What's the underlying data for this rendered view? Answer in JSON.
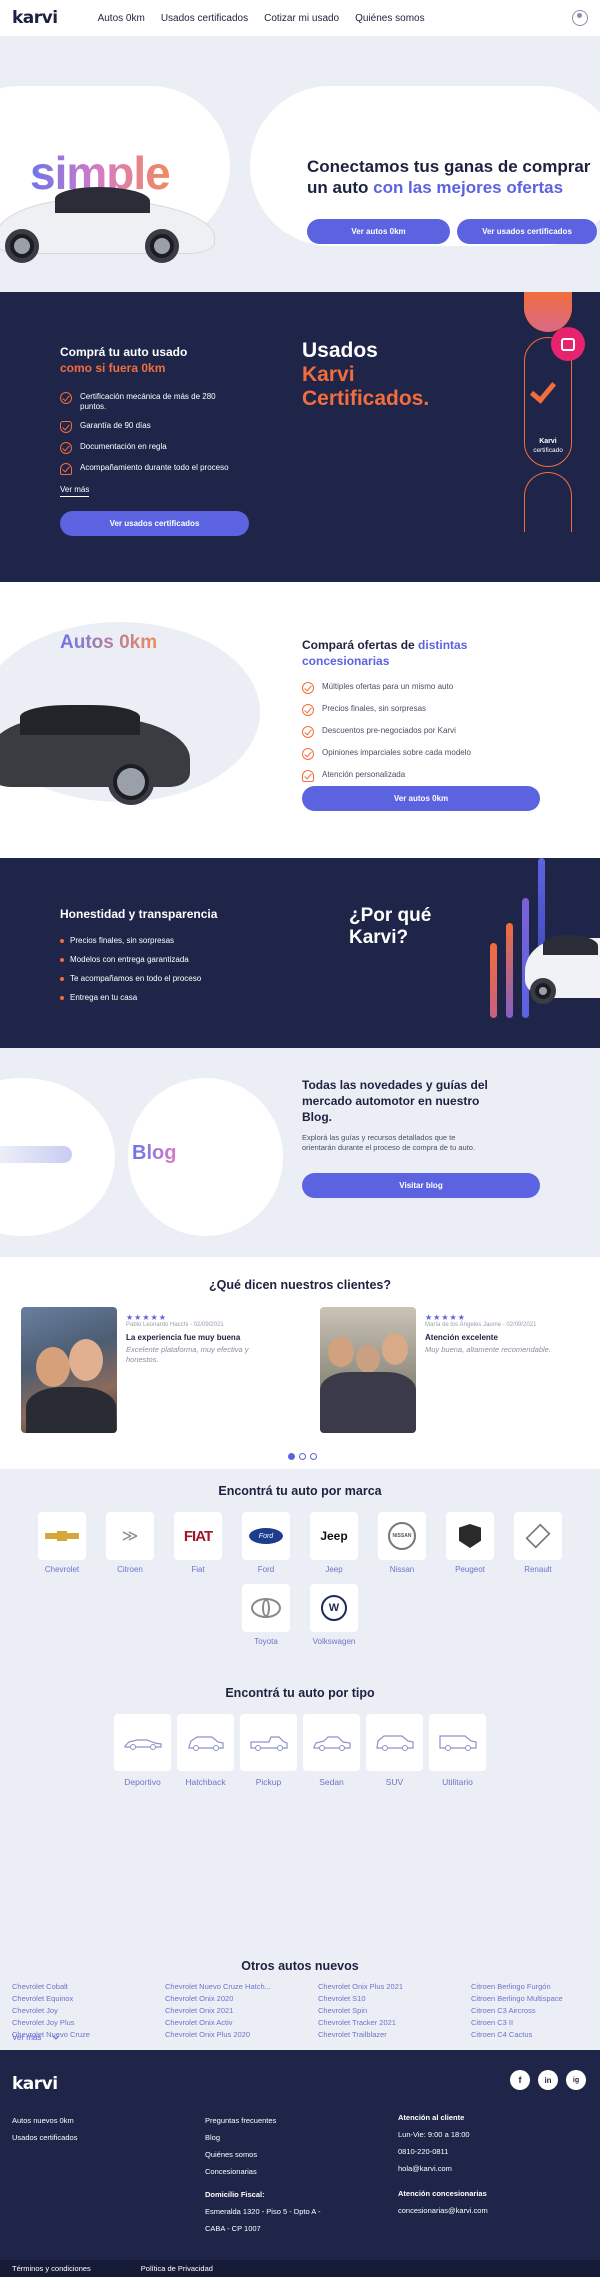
{
  "nav": {
    "logo": "karvi",
    "links": [
      "Autos 0km",
      "Usados certificados",
      "Cotizar mi usado",
      "Quiénes somos"
    ]
  },
  "hero": {
    "word": "simple",
    "title_a": "Conectamos tus ganas de comprar un auto ",
    "title_b": "con las mejores ofertas",
    "btn_0km": "Ver autos 0km",
    "btn_usados": "Ver usados certificados"
  },
  "usados": {
    "title_a": "Comprá tu auto usado",
    "title_b": "como si fuera 0km",
    "items": [
      "Certificación mecánica de más de 280 puntos.",
      "Garantía de 90 días",
      "Documentación en regla",
      "Acompañamiento durante todo el proceso"
    ],
    "ver_mas": "Ver más",
    "btn": "Ver usados certificados",
    "big_a": "Usados",
    "big_b": "Karvi",
    "big_c": "Certificados.",
    "badge_a": "Karvi",
    "badge_b": "certificado"
  },
  "okm": {
    "word": "Autos 0km",
    "title_a": "Compará ofertas de ",
    "title_b": "distintas concesionarias",
    "items": [
      "Múltiples ofertas para un mismo auto",
      "Precios finales, sin sorpresas",
      "Descuentos pre-negociados por Karvi",
      "Opiniones imparciales sobre cada modelo",
      "Atención personalizada"
    ],
    "btn": "Ver autos 0km"
  },
  "porque": {
    "title": "Honestidad y transparencia",
    "items": [
      "Precios finales, sin sorpresas",
      "Modelos con entrega garantizada",
      "Te acompañamos en todo el proceso",
      "Entrega en tu casa"
    ],
    "big_a": "¿Por qué",
    "big_b": "Karvi?"
  },
  "blog": {
    "word": "Blog",
    "title": "Todas las novedades y guías del mercado automotor en nuestro Blog.",
    "text": "Explorá las guías y recursos detallados que te orientarán durante el proceso de compra de tu auto.",
    "btn": "Visitar blog"
  },
  "testimonials": {
    "title": "¿Qué dicen nuestros clientes?",
    "items": [
      {
        "stars": "★★★★★",
        "meta": "Pablo Leonardo Hacchi - 02/09/2021",
        "title": "La experiencia fue muy buena",
        "quote": "Excelente plataforma, muy efectiva y honestos."
      },
      {
        "stars": "★★★★★",
        "meta": "María de los Ángeles Jaume - 02/09/2021",
        "title": "Atención excelente",
        "quote": "Muy buena, altamente recomendable."
      }
    ]
  },
  "brands": {
    "title": "Encontrá tu auto por marca",
    "items": [
      "Chevrolet",
      "Citroen",
      "Fiat",
      "Ford",
      "Jeep",
      "Nissan",
      "Peugeot",
      "Renault",
      "Toyota",
      "Volkswagen"
    ]
  },
  "types": {
    "title": "Encontrá tu auto por tipo",
    "items": [
      "Deportivo",
      "Hatchback",
      "Pickup",
      "Sedan",
      "SUV",
      "Utilitario"
    ]
  },
  "otros": {
    "title": "Otros autos nuevos",
    "items": [
      "Chevrolet Cobalt",
      "Chevrolet Equinox",
      "Chevrolet Joy",
      "Chevrolet Joy Plus",
      "Chevrolet Nuevo Cruze",
      "Chevrolet Nuevo Cruze Hatch...",
      "Chevrolet Onix 2020",
      "Chevrolet Onix 2021",
      "Chevrolet Onix Activ",
      "Chevrolet Onix Plus 2020",
      "Chevrolet Onix Plus 2021",
      "Chevrolet S10",
      "Chevrolet Spin",
      "Chevrolet Tracker 2021",
      "Chevrolet Trailblazer",
      "Citroen Berlingo Furgón",
      "Citroen Berlingo Multispace",
      "Citroen C3 Aircross",
      "Citroen C3 II",
      "Citroen C4 Cactus"
    ],
    "ver_mas": "Ver más"
  },
  "footer": {
    "logo": "karvi",
    "social": [
      "f",
      "in",
      "ig"
    ],
    "col1": [
      "Autos nuevos 0km",
      "Usados certificados"
    ],
    "col2": [
      "Preguntas frecuentes",
      "Blog",
      "Quiénes somos",
      "Concesionarias"
    ],
    "domicilio_h": "Domicilio Fiscal:",
    "domicilio": [
      "Esmeralda 1320 - Piso 5 - Dpto A -",
      "CABA - CP 1007"
    ],
    "atencion_h": "Atención al cliente",
    "atencion": [
      "Lun-Vie: 9:00 a 18:00",
      "0810-220-0811",
      "hola@karvi.com"
    ],
    "conc_h": "Atención concesionarias",
    "conc": "concesionarias@karvi.com",
    "terminos": "Términos y condiciones",
    "privacidad": "Política de Privacidad"
  },
  "colors": {
    "primary": "#5b63e0",
    "accent": "#f26d3d",
    "navy": "#1f2548",
    "bg": "#eceef6"
  }
}
